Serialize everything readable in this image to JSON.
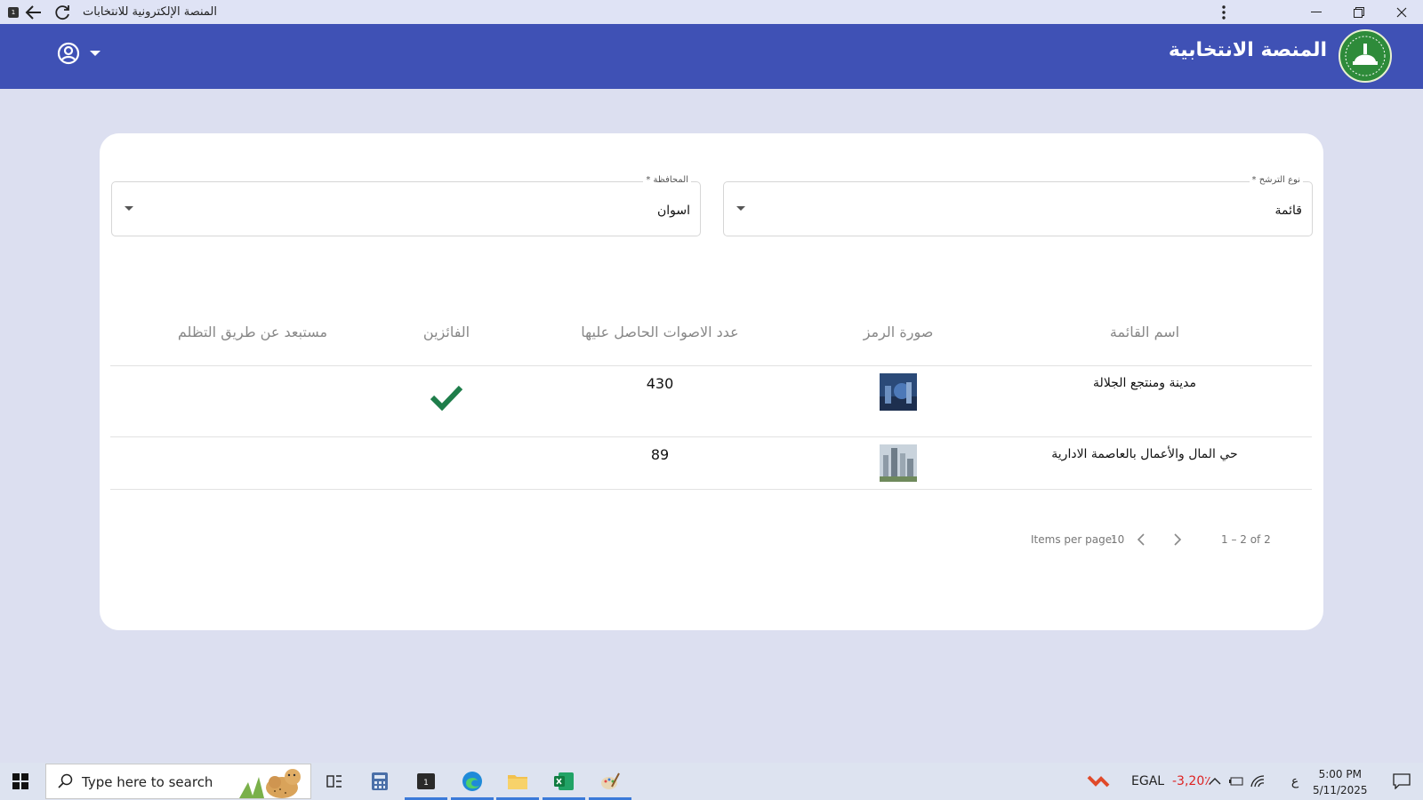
{
  "window": {
    "title": "المنصة الإلكترونية للانتخابات",
    "badge": "1"
  },
  "header": {
    "title": "المنصة الانتخابية"
  },
  "filters": {
    "type": {
      "label": "نوع الترشح *",
      "value": "قائمة"
    },
    "governorate": {
      "label": "المحافظة *",
      "value": "اسوان"
    }
  },
  "table": {
    "headers": [
      "اسم القائمة",
      "صورة الرمز",
      "عدد الاصوات الحاصل عليها",
      "الفائزين",
      "مستبعد عن طريق التظلم"
    ],
    "rows": [
      {
        "name": "مدينة ومنتجع الجلالة",
        "votes": "430",
        "winner": true
      },
      {
        "name": "حي المال والأعمال بالعاصمة الادارية",
        "votes": "89",
        "winner": false
      }
    ]
  },
  "paginator": {
    "items_label": "Items per page:",
    "page_size": "10",
    "range": "1 – 2 of 2"
  },
  "taskbar": {
    "search_placeholder": "Type here to search",
    "stock_name": "EGAL",
    "stock_change": "-3,20٪",
    "lang": "ع",
    "time": "5:00 PM",
    "date": "5/11/2025"
  },
  "colors": {
    "appbar": "#3f51b5",
    "check": "#1e7d4a",
    "background": "#dcdff0"
  }
}
